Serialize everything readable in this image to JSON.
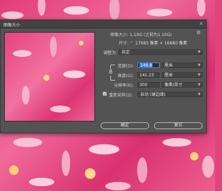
{
  "dialog": {
    "title": "图像大小",
    "close_glyph": "×",
    "image_size_label": "图像大小:",
    "image_size_value": "1.10G (之前为1.10G)",
    "dimensions_label": "尺寸:",
    "dimensions_value": "17683 像素 × 16680 像素",
    "fit_label": "调整为:",
    "fit_value": "自定",
    "width_label": "宽度(D):",
    "width_value": "149.8",
    "width_unit": "厘米",
    "height_label": "高度(G):",
    "height_value": "141.23",
    "height_unit": "厘米",
    "resolution_label": "分辨率(R):",
    "resolution_value": "300",
    "resolution_unit": "像素/英寸",
    "resample_label": "重新采样(S):",
    "resample_checked": true,
    "resample_value": "自动 (硬边缘)",
    "ok_label": "确定",
    "reset_label": "复位"
  },
  "icons": {
    "gear": "gear-icon",
    "link": "link-icon",
    "close": "close-icon",
    "chevron": "chevron-down-icon"
  },
  "colors": {
    "dialog_bg": "#535353",
    "titlebar_bg": "#424242",
    "selection": "#3a7bd5",
    "background_pink": "#e0447d"
  }
}
